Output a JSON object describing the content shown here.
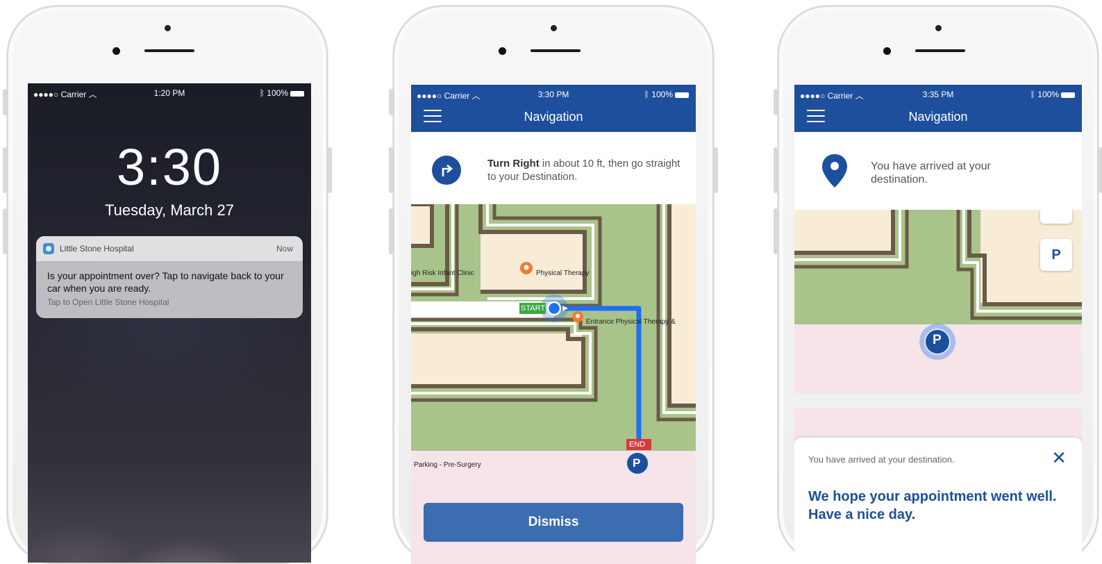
{
  "phone1": {
    "status": {
      "carrier": "Carrier",
      "time": "1:20 PM",
      "battery": "100%"
    },
    "lock_time": "3:30",
    "lock_date": "Tuesday, March 27",
    "notification": {
      "app_name": "Little Stone Hospital",
      "when": "Now",
      "message": "Is your appointment over? Tap to navigate back to your car when you are ready.",
      "action_hint": "Tap to Open Little Stone Hospital"
    }
  },
  "phone2": {
    "status": {
      "carrier": "Carrier",
      "time": "3:30 PM",
      "battery": "100%"
    },
    "title": "Navigation",
    "instruction_bold": "Turn Right",
    "instruction_rest": " in about 10 ft, then go straight to your Destination.",
    "map_labels": {
      "clinic": "igh Risk Infant Clinic",
      "physical_therapy": "Physical  Therapy",
      "entrance": "Entrance Physical Therapy &",
      "start": "START",
      "end": "END",
      "parking": "Parking - Pre-Surgery",
      "parking_marker": "P"
    },
    "dismiss_label": "Dismiss"
  },
  "phone3": {
    "status": {
      "carrier": "Carrier",
      "time": "3:35 PM",
      "battery": "100%"
    },
    "title": "Navigation",
    "arrived_banner": "You have arrived at your destination.",
    "parking_button": "P",
    "parking_marker": "P",
    "card": {
      "small": "You have arrived at your destination.",
      "close": "✕",
      "message": "We hope your appointment went well. Have a nice day."
    }
  },
  "colors": {
    "brand_blue": "#1e4f9c",
    "route_blue": "#1f6ff2",
    "map_green": "#a9c48a",
    "map_building": "#f8ecd7",
    "map_parking": "#f6e4e8"
  }
}
